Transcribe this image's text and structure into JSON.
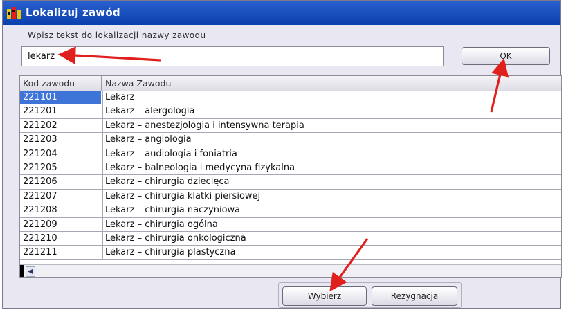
{
  "window": {
    "title": "Lokalizuj zawód"
  },
  "search": {
    "prompt": "Wpisz tekst do lokalizacji nazwy zawodu",
    "value": "lekarz"
  },
  "buttons": {
    "ok": "OK",
    "select": "Wybierz",
    "cancel": "Rezygnacja"
  },
  "table": {
    "headers": [
      "Kod zawodu",
      "Nazwa Zawodu"
    ],
    "rows": [
      {
        "code": "221101",
        "name": "Lekarz"
      },
      {
        "code": "221201",
        "name": "Lekarz – alergologia"
      },
      {
        "code": "221202",
        "name": "Lekarz – anestezjologia i intensywna terapia"
      },
      {
        "code": "221203",
        "name": "Lekarz – angiologia"
      },
      {
        "code": "221204",
        "name": "Lekarz – audiologia i foniatria"
      },
      {
        "code": "221205",
        "name": "Lekarz – balneologia i medycyna fizykalna"
      },
      {
        "code": "221206",
        "name": "Lekarz – chirurgia dziecięca"
      },
      {
        "code": "221207",
        "name": "Lekarz – chirurgia klatki piersiowej"
      },
      {
        "code": "221208",
        "name": "Lekarz – chirurgia naczyniowa"
      },
      {
        "code": "221209",
        "name": "Lekarz – chirurgia ogólna"
      },
      {
        "code": "221210",
        "name": "Lekarz – chirurgia onkologiczna"
      },
      {
        "code": "221211",
        "name": "Lekarz – chirurgia plastyczna"
      }
    ],
    "selected_row": 0
  },
  "colors": {
    "titlebar": "#1848b8",
    "selection": "#3e73d8",
    "annotation_arrow": "#e0201c"
  }
}
